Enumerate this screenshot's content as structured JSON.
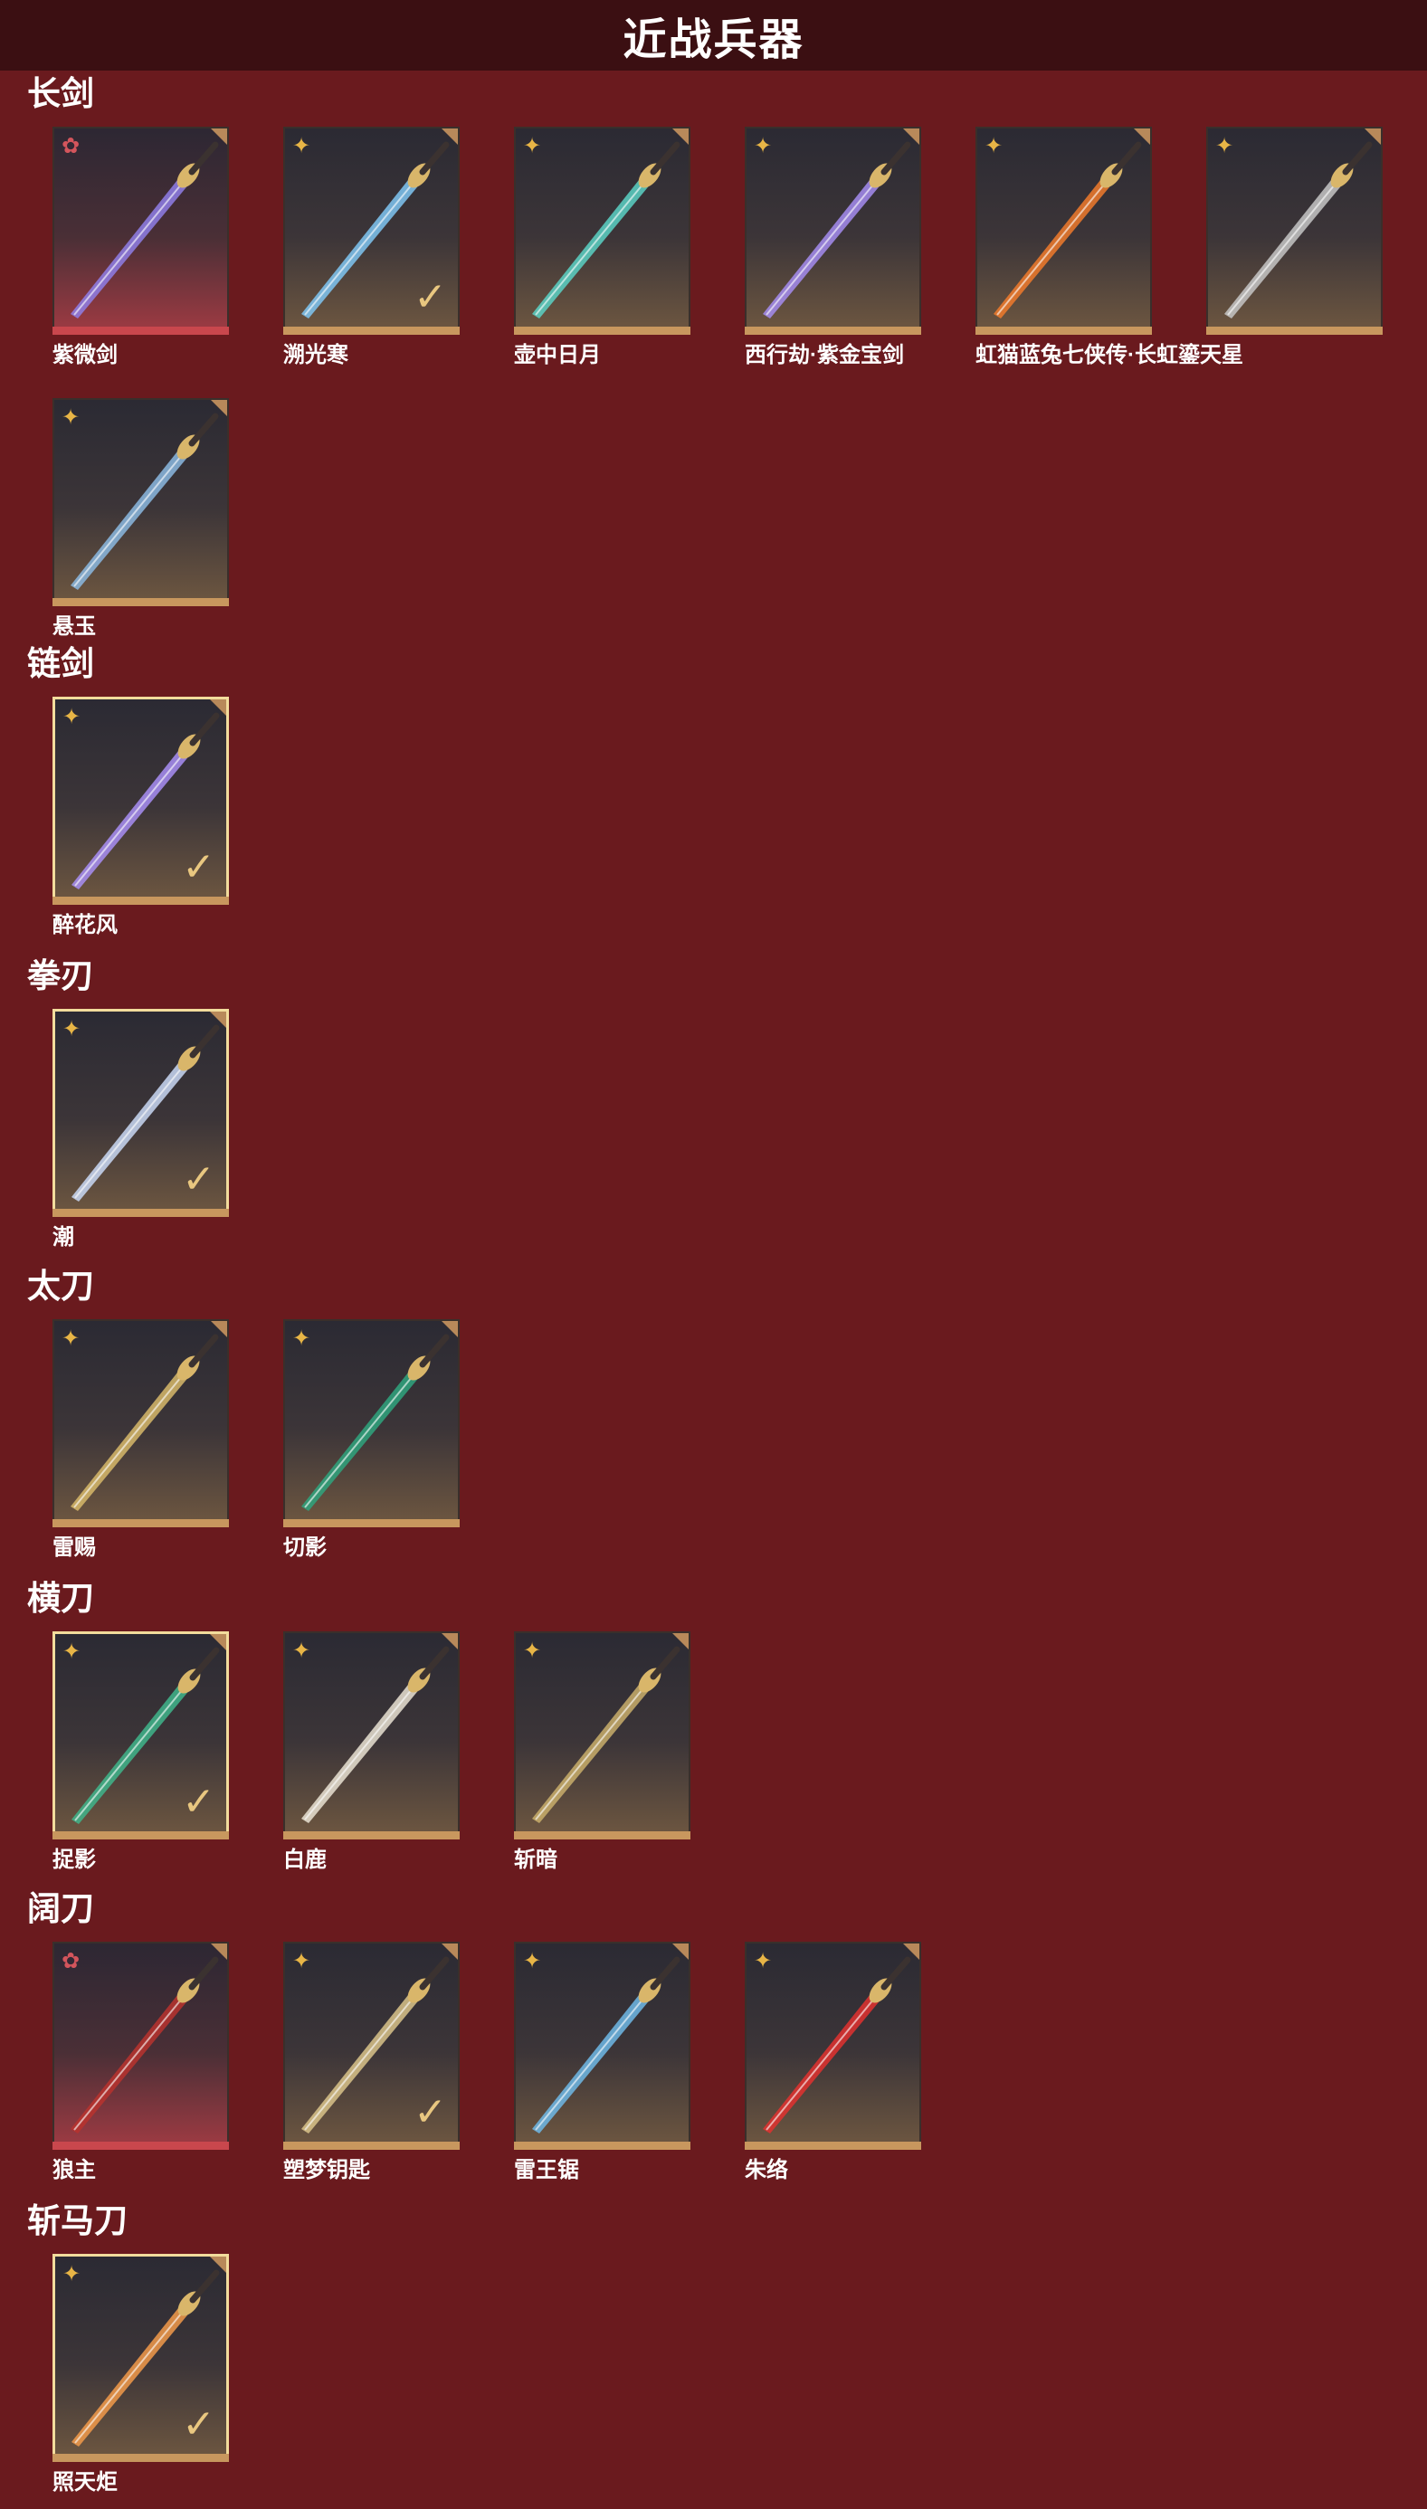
{
  "page_title": "近战兵器",
  "sections": [
    {
      "title": "长剑",
      "items": [
        {
          "name": "紫微剑",
          "rarity": "red",
          "selected": false,
          "checked": false,
          "accent": "#8f7ee6"
        },
        {
          "name": "溯光寒",
          "rarity": "gold",
          "selected": false,
          "checked": true,
          "accent": "#7fc6f2"
        },
        {
          "name": "壶中日月",
          "rarity": "gold",
          "selected": false,
          "checked": false,
          "accent": "#5bd1c4"
        },
        {
          "name": "西行劫·紫金宝剑",
          "rarity": "gold",
          "selected": false,
          "checked": false,
          "accent": "#a58cf0"
        },
        {
          "name": "虹猫蓝兔七侠传·长虹鎏天星",
          "rarity": "gold",
          "selected": false,
          "checked": false,
          "accent": "#f07a2c"
        },
        {
          "name": "",
          "rarity": "gold",
          "selected": false,
          "checked": false,
          "accent": "#c6c6c6"
        }
      ],
      "items_row2": [
        {
          "name": "悬玉",
          "rarity": "gold",
          "selected": false,
          "checked": false,
          "accent": "#8bb9e0"
        }
      ]
    },
    {
      "title": "链剑",
      "items": [
        {
          "name": "醉花风",
          "rarity": "gold",
          "selected": true,
          "checked": true,
          "accent": "#a88ef5"
        }
      ]
    },
    {
      "title": "拳刃",
      "items": [
        {
          "name": "潮",
          "rarity": "gold",
          "selected": true,
          "checked": true,
          "accent": "#c9d8f5"
        }
      ]
    },
    {
      "title": "太刀",
      "items": [
        {
          "name": "雷赐",
          "rarity": "gold",
          "selected": false,
          "checked": false,
          "accent": "#d7b86a"
        },
        {
          "name": "切影",
          "rarity": "gold",
          "selected": false,
          "checked": false,
          "accent": "#2fa57e"
        }
      ]
    },
    {
      "title": "横刀",
      "items": [
        {
          "name": "捉影",
          "rarity": "gold",
          "selected": true,
          "checked": true,
          "accent": "#3fb58b"
        },
        {
          "name": "白鹿",
          "rarity": "gold",
          "selected": false,
          "checked": false,
          "accent": "#e9e2d2"
        },
        {
          "name": "斩暗",
          "rarity": "gold",
          "selected": false,
          "checked": false,
          "accent": "#c9ae6b"
        }
      ]
    },
    {
      "title": "阔刀",
      "items": [
        {
          "name": "狼主",
          "rarity": "red",
          "selected": false,
          "checked": false,
          "accent": "#b8322e"
        },
        {
          "name": "塑梦钥匙",
          "rarity": "gold",
          "selected": false,
          "checked": true,
          "accent": "#d9c389"
        },
        {
          "name": "雷王锯",
          "rarity": "gold",
          "selected": false,
          "checked": false,
          "accent": "#6fb8e6"
        },
        {
          "name": "朱络",
          "rarity": "gold",
          "selected": false,
          "checked": false,
          "accent": "#e2312f"
        }
      ]
    },
    {
      "title": "斩马刀",
      "items": [
        {
          "name": "照天炬",
          "rarity": "gold",
          "selected": true,
          "checked": true,
          "accent": "#f29a4a"
        }
      ]
    }
  ],
  "icons": {
    "rank_gold": "four-point-star-icon",
    "rank_red": "flower-star-icon",
    "check": "checkmark-icon"
  }
}
